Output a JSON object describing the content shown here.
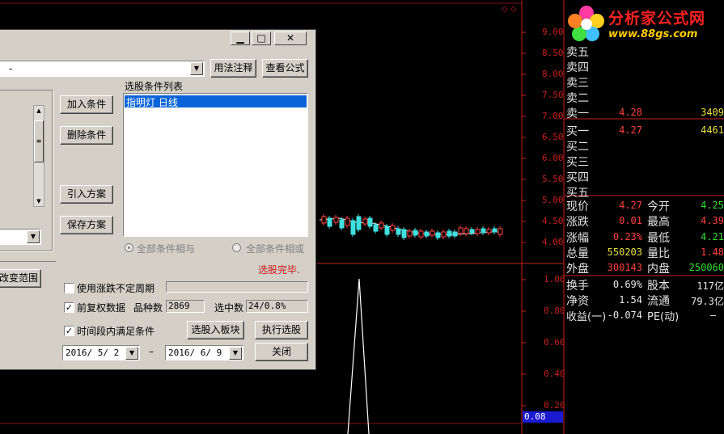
{
  "logo": {
    "title": "分析家公式网",
    "url": "www.88gs.com"
  },
  "price_axis": [
    "9.00",
    "8.50",
    "8.00",
    "7.50",
    "7.00",
    "6.50",
    "6.00",
    "5.50",
    "5.00",
    "4.50",
    "4.00"
  ],
  "indicator_axis": [
    "1.00",
    "0.80",
    "0.60",
    "0.40",
    "0.20"
  ],
  "indicator_current": "0.08",
  "order_book": {
    "sell": [
      {
        "label": "卖五",
        "price": "",
        "vol": ""
      },
      {
        "label": "卖四",
        "price": "",
        "vol": ""
      },
      {
        "label": "卖三",
        "price": "",
        "vol": ""
      },
      {
        "label": "卖二",
        "price": "",
        "vol": ""
      },
      {
        "label": "卖一",
        "price": "4.28",
        "vol": "3409"
      }
    ],
    "buy": [
      {
        "label": "买一",
        "price": "4.27",
        "vol": "4461"
      },
      {
        "label": "买二",
        "price": "",
        "vol": ""
      },
      {
        "label": "买三",
        "price": "",
        "vol": ""
      },
      {
        "label": "买四",
        "price": "",
        "vol": ""
      },
      {
        "label": "买五",
        "price": "",
        "vol": ""
      }
    ]
  },
  "quote": {
    "xianjia_label": "现价",
    "xianjia": "4.27",
    "jinkai_label": "今开",
    "jinkai": "4.25",
    "zhangdie_label": "涨跌",
    "zhangdie": "0.01",
    "zuigao_label": "最高",
    "zuigao": "4.39",
    "zhangfu_label": "涨幅",
    "zhangfu": "0.23%",
    "zuidi_label": "最低",
    "zuidi": "4.21",
    "zongliang_label": "总量",
    "zongliang": "550203",
    "liangbi_label": "量比",
    "liangbi": "1.48",
    "waipan_label": "外盘",
    "waipan": "300143",
    "neipan_label": "内盘",
    "neipan": "250060",
    "huanshou_label": "换手",
    "huanshou": "0.69%",
    "guben_label": "股本",
    "guben": "117亿",
    "jingzi_label": "净资",
    "jingzi": "1.54",
    "liutong_label": "流通",
    "liutong": "79.3亿",
    "shouyi_label": "收益(一)",
    "shouyi": "-0.074",
    "pe_label": "PE(动)",
    "pe": "–"
  },
  "dialog": {
    "minimize": "▁",
    "maximize": "□",
    "close": "✕",
    "combo_value": "-",
    "btn_usage": "用法注释",
    "btn_view_formula": "查看公式",
    "condition_list_label": "选股条件列表",
    "conditions": [
      "指明灯  日线"
    ],
    "btn_add": "加入条件",
    "btn_delete": "删除条件",
    "btn_import": "引入方案",
    "btn_save": "保存方案",
    "radio_all_and": "全部条件相与",
    "radio_all_or": "全部条件相或",
    "status": "选股完毕.",
    "btn_change_range": "改变范围",
    "cb_irregular_label": "使用涨跌不定周期",
    "cb_irregular": false,
    "cb_prerights_label": "前复权数据",
    "cb_prerights": true,
    "count_label": "品种数",
    "count_value": "2869",
    "selected_label": "选中数",
    "selected_value": "24/0.8%",
    "cb_period_label": "时间段内满足条件",
    "cb_period": true,
    "btn_to_block": "选股入板块",
    "btn_execute": "执行选股",
    "date_from": "2016/ 5/ 2",
    "date_sep": "–",
    "date_to": "2016/ 6/ 9",
    "btn_close": "关闭"
  },
  "colors": {
    "axis": "#c8201c",
    "up": "#ff4040",
    "down": "#30e030",
    "volume": "#e8e040",
    "bg": "#000000"
  }
}
